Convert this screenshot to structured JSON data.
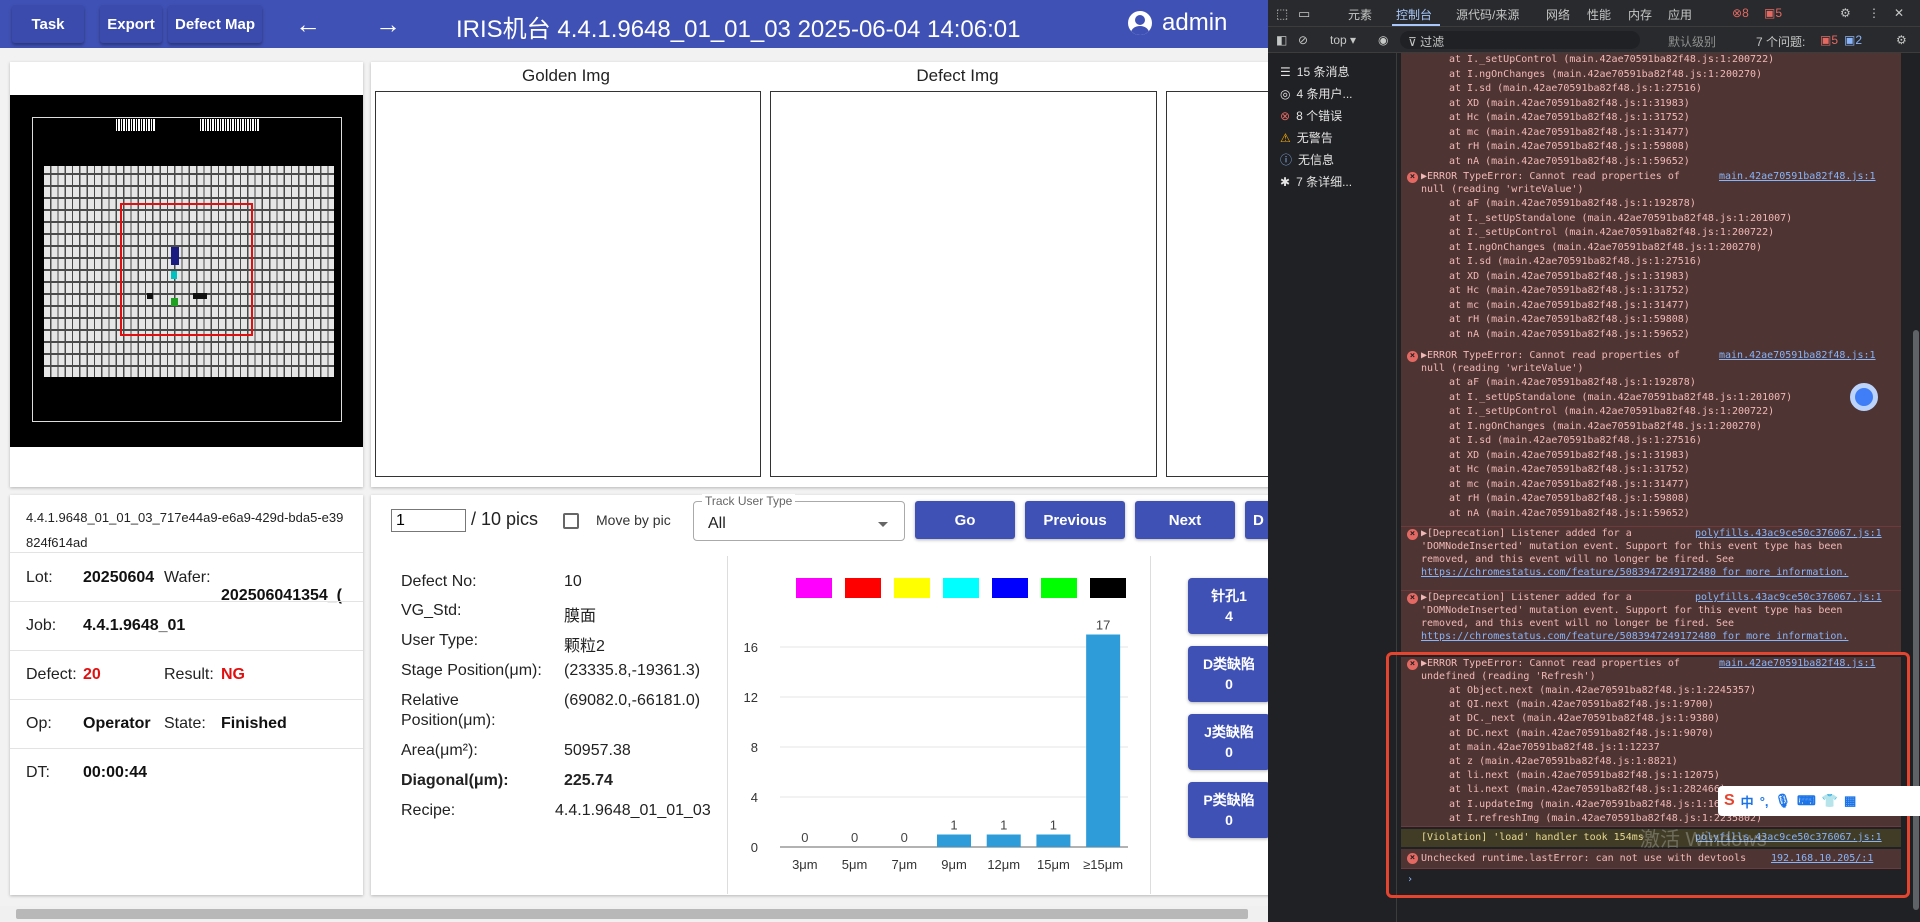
{
  "app": {
    "nav": {
      "task": "Task",
      "export": "Export",
      "defect_map": "Defect Map",
      "back_icon": "←",
      "forward_icon": "→"
    },
    "title": "IRIS机台   4.4.1.9648_01_01_03   2025-06-04 14:06:01",
    "user": "admin",
    "images": {
      "golden": "Golden Img",
      "defect": "Defect Img"
    },
    "info": {
      "uid": "4.4.1.9648_01_01_03_717e44a9-e6a9-429d-bda5-e39824f614ad",
      "lot_label": "Lot:",
      "lot": "20250604",
      "wafer_label": "Wafer:",
      "wafer": "202506041354_(",
      "job_label": "Job:",
      "job": "4.4.1.9648_01",
      "defect_label": "Defect:",
      "defect": "20",
      "result_label": "Result:",
      "result": "NG",
      "op_label": "Op:",
      "op": "Operator",
      "state_label": "State:",
      "state": "Finished",
      "dt_label": "DT:",
      "dt": "00:00:44"
    },
    "controls": {
      "page_value": "1",
      "page_total": "/ 10 pics",
      "move_by_pic": "Move by pic",
      "track_label": "Track User Type",
      "track_value": "All",
      "go": "Go",
      "previous": "Previous",
      "next": "Next",
      "more": "D"
    },
    "defect": {
      "no_label": "Defect No:",
      "no": "10",
      "vg_label": "VG_Std:",
      "vg": "膜面",
      "user_type_label": "User Type:",
      "user_type": "颗粒2",
      "stage_label": "Stage Position(μm):",
      "stage": "(23335.8,-19361.3)",
      "relative_label_1": "Relative",
      "relative_label_2": "Position(μm):",
      "relative": "(69082.0,-66181.0)",
      "area_label": "Area(μm²):",
      "area": "50957.38",
      "diagonal_label": "Diagonal(μm):",
      "diagonal": "225.74",
      "recipe_label": "Recipe:",
      "recipe": "4.4.1.9648_01_01_03"
    },
    "class_buttons": [
      {
        "label": "针孔1",
        "count": "4"
      },
      {
        "label": "D类缺陷",
        "count": "0"
      },
      {
        "label": "J类缺陷",
        "count": "0"
      },
      {
        "label": "P类缺陷",
        "count": "0"
      }
    ]
  },
  "chart_data": {
    "type": "bar",
    "categories": [
      "3μm",
      "5μm",
      "7μm",
      "9μm",
      "12μm",
      "15μm",
      "≥15μm"
    ],
    "values": [
      0,
      0,
      0,
      1,
      1,
      1,
      17
    ],
    "yticks": [
      0,
      4,
      8,
      12,
      16
    ],
    "ylim": [
      0,
      18
    ],
    "bar_color": "#2e9cd8",
    "legend_swatches": [
      "#ff00ff",
      "#ff0000",
      "#ffff00",
      "#00ffff",
      "#0000ff",
      "#00ff00",
      "#000000"
    ],
    "title": "",
    "xlabel": "",
    "ylabel": ""
  },
  "devtools": {
    "tabs": [
      "元素",
      "控制台",
      "源代码/来源",
      "网络",
      "性能",
      "内存",
      "应用"
    ],
    "errors_count": "8",
    "warnings_count": "5",
    "context": "top",
    "filter": "过滤",
    "levels": "默认级别",
    "issues": "7 个问题:",
    "issues_err": "5",
    "issues_info": "2",
    "sidebar": [
      "15 条消息",
      "4 条用户...",
      "8 个错误",
      "无警告",
      "无信息",
      "7 条详细..."
    ],
    "stack_a": [
      "at I._setUpControl (main.42ae70591ba82f48.js:1:200722)",
      "at I.ngOnChanges (main.42ae70591ba82f48.js:1:200270)",
      "at I.sd (main.42ae70591ba82f48.js:1:27516)",
      "at XD (main.42ae70591ba82f48.js:1:31983)",
      "at Hc (main.42ae70591ba82f48.js:1:31752)",
      "at mc (main.42ae70591ba82f48.js:1:31477)",
      "at rH (main.42ae70591ba82f48.js:1:59808)",
      "at nA (main.42ae70591ba82f48.js:1:59652)"
    ],
    "err_head_1": "▶ERROR TypeError: Cannot read properties of",
    "err_head_2": "null (reading 'writeValue')",
    "err_src": "main.42ae70591ba82f48.js:1",
    "stack_b": [
      "at aF (main.42ae70591ba82f48.js:1:192878)",
      "at I._setUpStandalone (main.42ae70591ba82f48.js:1:201007)",
      "at I._setUpControl (main.42ae70591ba82f48.js:1:200722)",
      "at I.ngOnChanges (main.42ae70591ba82f48.js:1:200270)",
      "at I.sd (main.42ae70591ba82f48.js:1:27516)",
      "at XD (main.42ae70591ba82f48.js:1:31983)",
      "at Hc (main.42ae70591ba82f48.js:1:31752)",
      "at mc (main.42ae70591ba82f48.js:1:31477)",
      "at rH (main.42ae70591ba82f48.js:1:59808)",
      "at nA (main.42ae70591ba82f48.js:1:59652)"
    ],
    "dep_src": "polyfills.43ac9ce50c376067.js:1",
    "dep": [
      "▶[Deprecation] Listener added for a",
      "'DOMNodeInserted' mutation event. Support for this event type has been",
      "removed, and this event will no longer be fired. See",
      "https://chromestatus.com/feature/5083947249172480 for more information."
    ],
    "err3_head_1": "▶ERROR TypeError: Cannot read properties of",
    "err3_head_2": "undefined (reading 'Refresh')",
    "stack_c": [
      "at Object.next (main.42ae70591ba82f48.js:1:2245357)",
      "at QI.next (main.42ae70591ba82f48.js:1:9700)",
      "at DC._next (main.42ae70591ba82f48.js:1:9380)",
      "at DC.next (main.42ae70591ba82f48.js:1:9070)",
      "at main.42ae70591ba82f48.js:1:12237",
      "at z (main.42ae70591ba82f48.js:1:8821)",
      "at li.next (main.42ae70591ba82f48.js:1:12075)",
      "at li.next (main.42ae70591ba82f48.js:1:282466)",
      "at I.updateImg (main.42ae70591ba82f48.js:1:1662)",
      "at I.refreshImg (main.42ae70591ba82f48.js:1:2235802)"
    ],
    "violation": "[Violation] 'load' handler took 154ms",
    "violation_src": "polyfills.43ac9ce50c376067.js:1",
    "runtime": "Unchecked runtime.lastError: can not use with devtools",
    "runtime_src": "192.168.10.205/:1",
    "ime": "中",
    "watermark": "激活 Windows"
  }
}
